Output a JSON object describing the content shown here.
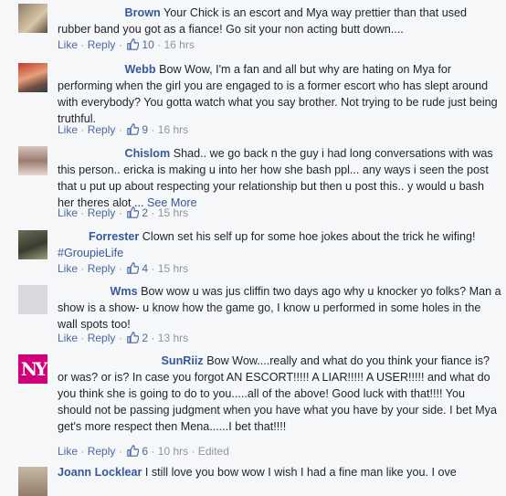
{
  "actions": {
    "like": "Like",
    "reply": "Reply",
    "dot": "·"
  },
  "comments": [
    {
      "name": "Brown",
      "text": "Your Chick is an escort and Mya way prettier than that used rubber band you got as a fiance! Go sit your non acting butt down....",
      "likes": "10",
      "time": "16 hrs",
      "edited": ""
    },
    {
      "name": "Webb",
      "text": "Bow Wow, I'm a fan and all but why are hating on Mya for performing when the girl you are engaged to is a former escort who has slept around with everybody? You gotta watch what you say brother. Not trying to be rude just being truthful.",
      "likes": "9",
      "time": "16 hrs",
      "edited": ""
    },
    {
      "name": "Chislom",
      "text": "Shad.. we go back n the guy i had long conversations with was this person.. ericka is making u into her how she bash ppl... any ways i seen the post that u put up about respecting your relationship but then u post this.. y would u bash her theres alot ...",
      "see_more": "See More",
      "likes": "2",
      "time": "15 hrs",
      "edited": ""
    },
    {
      "name": "Forrester",
      "text": "Clown set his self up for some hoe jokes about the trick he wifing!",
      "hashtag": "#GroupieLife",
      "likes": "4",
      "time": "15 hrs",
      "edited": ""
    },
    {
      "name": "Wms",
      "text": "Bow wow u was jus cliffin two days ago why u knocker yo folks? Man a show is a show- u know how the game go, I know u performed in some holes in the wall spots too!",
      "likes": "2",
      "time": "13 hrs",
      "edited": ""
    },
    {
      "name": "SunRiiz",
      "text": "Bow Wow....really and what do you think your fiance is? or was? or is? In case you forgot AN ESCORT!!!!! A LIAR!!!!! A USER!!!!! and what do you think she is going to do to you.....all of the above! Good luck with that!!!! You should not be passing judgment when you have what you have by your side. I bet Mya get's more respect then Mena......I bet that!!!!",
      "likes": "6",
      "time": "10 hrs",
      "edited": "Edited"
    },
    {
      "name": "Joann Locklear",
      "text": "I still love you bow wow I wish I had a fine man like you. I ove"
    }
  ],
  "avatar_logo": "NY",
  "colors": {
    "link": "#365899",
    "meta": "#90949c",
    "background": "#f6f7f9"
  }
}
